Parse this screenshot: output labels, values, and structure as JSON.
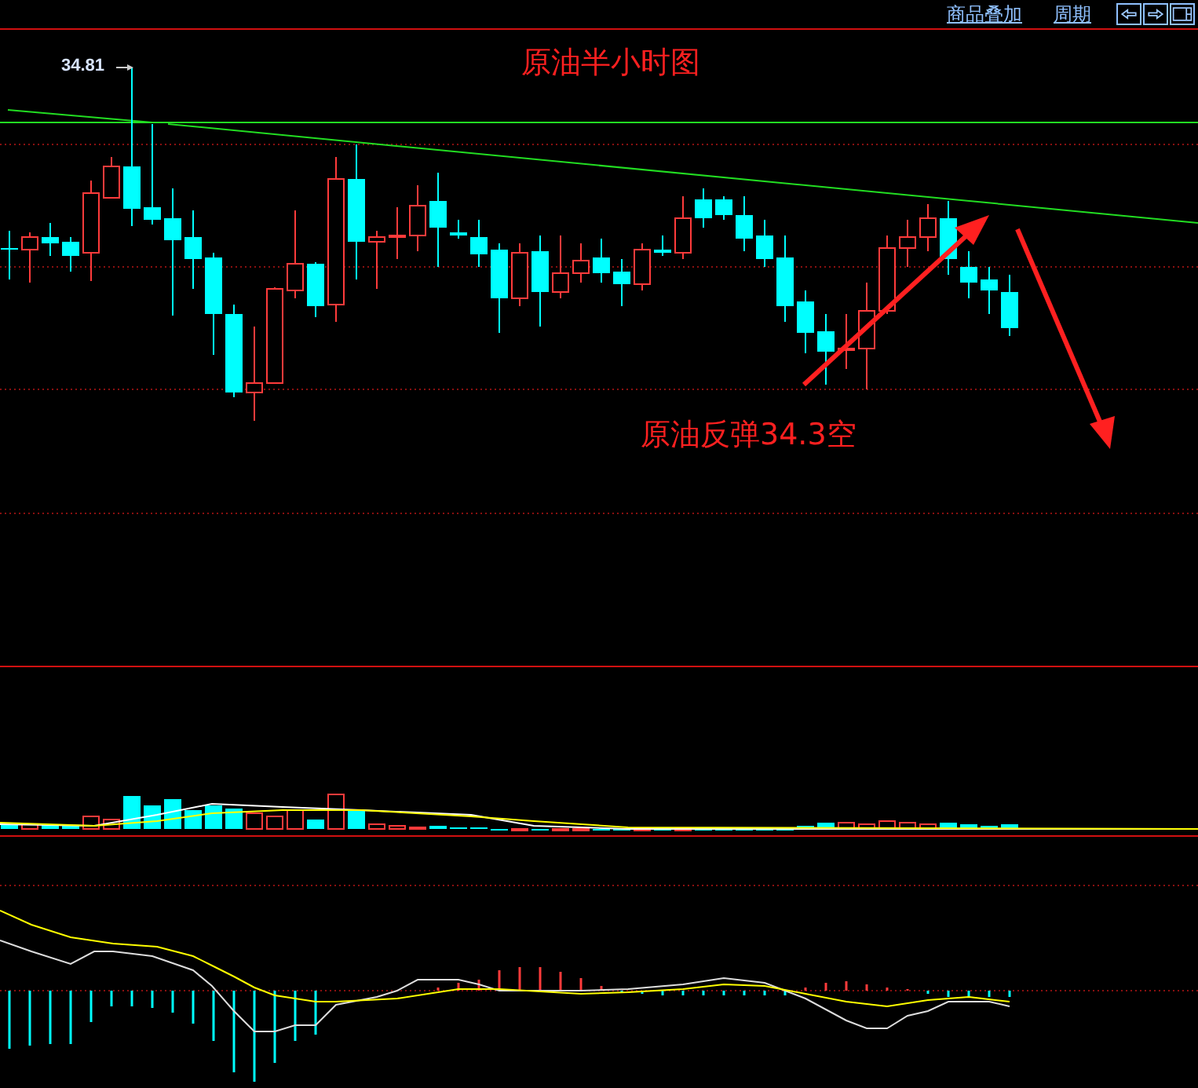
{
  "toolbar": {
    "links": [
      "商品叠加",
      "周期"
    ]
  },
  "chart": {
    "title": "原油半小时图",
    "high_label": "34.81",
    "annotation": "原油反弹34.3空"
  }
}
